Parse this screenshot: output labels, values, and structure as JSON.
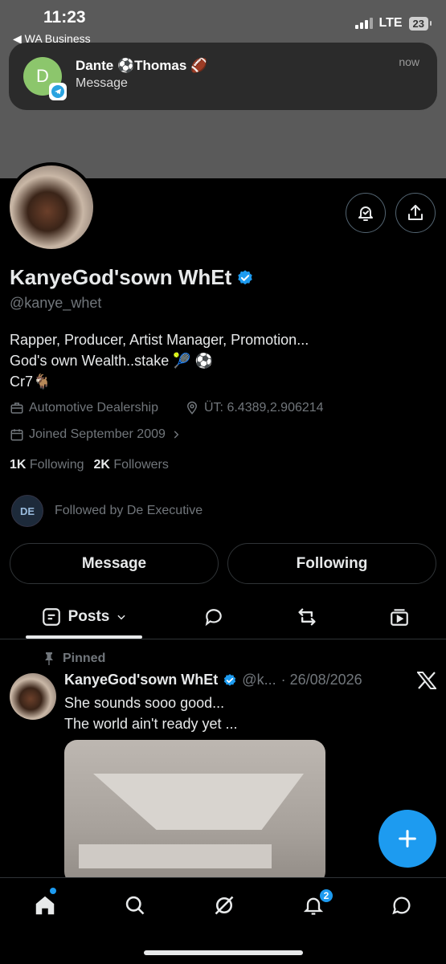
{
  "status_bar": {
    "time": "11:23",
    "back_app": "◀ WA Business",
    "network": "LTE",
    "battery": "23"
  },
  "notification": {
    "avatar_letter": "D",
    "title": "Dante ⚽Thomas 🏈",
    "message": "Message",
    "time": "now"
  },
  "profile": {
    "display_name": "KanyeGod'sown WhEt",
    "handle": "@kanye_whet",
    "bio_lines": [
      "Rapper, Producer, Artist Manager, Promotion...",
      "God's own Wealth..stake 🎾 ⚽",
      "Cr7🐐"
    ],
    "category": "Automotive Dealership",
    "location": "ÜT: 6.4389,2.906214",
    "joined": "Joined September 2009",
    "following_count": "1K",
    "following_label": "Following",
    "followers_count": "2K",
    "followers_label": "Followers",
    "followed_by": "Followed by De Executive",
    "followed_by_avatar_text": "DE"
  },
  "actions": {
    "message_label": "Message",
    "following_label": "Following"
  },
  "tabs": {
    "posts_label": "Posts"
  },
  "post": {
    "pinned_label": "Pinned",
    "author_name": "KanyeGod'sown WhEt",
    "author_handle": "@k...",
    "date": "· 26/08/2026",
    "text_lines": [
      "She sounds sooo good...",
      "The world ain't ready yet ..."
    ]
  },
  "bottom_nav": {
    "notification_badge": "2"
  },
  "colors": {
    "accent": "#1d9bf0",
    "background": "#000000",
    "secondary_text": "#71767b"
  }
}
